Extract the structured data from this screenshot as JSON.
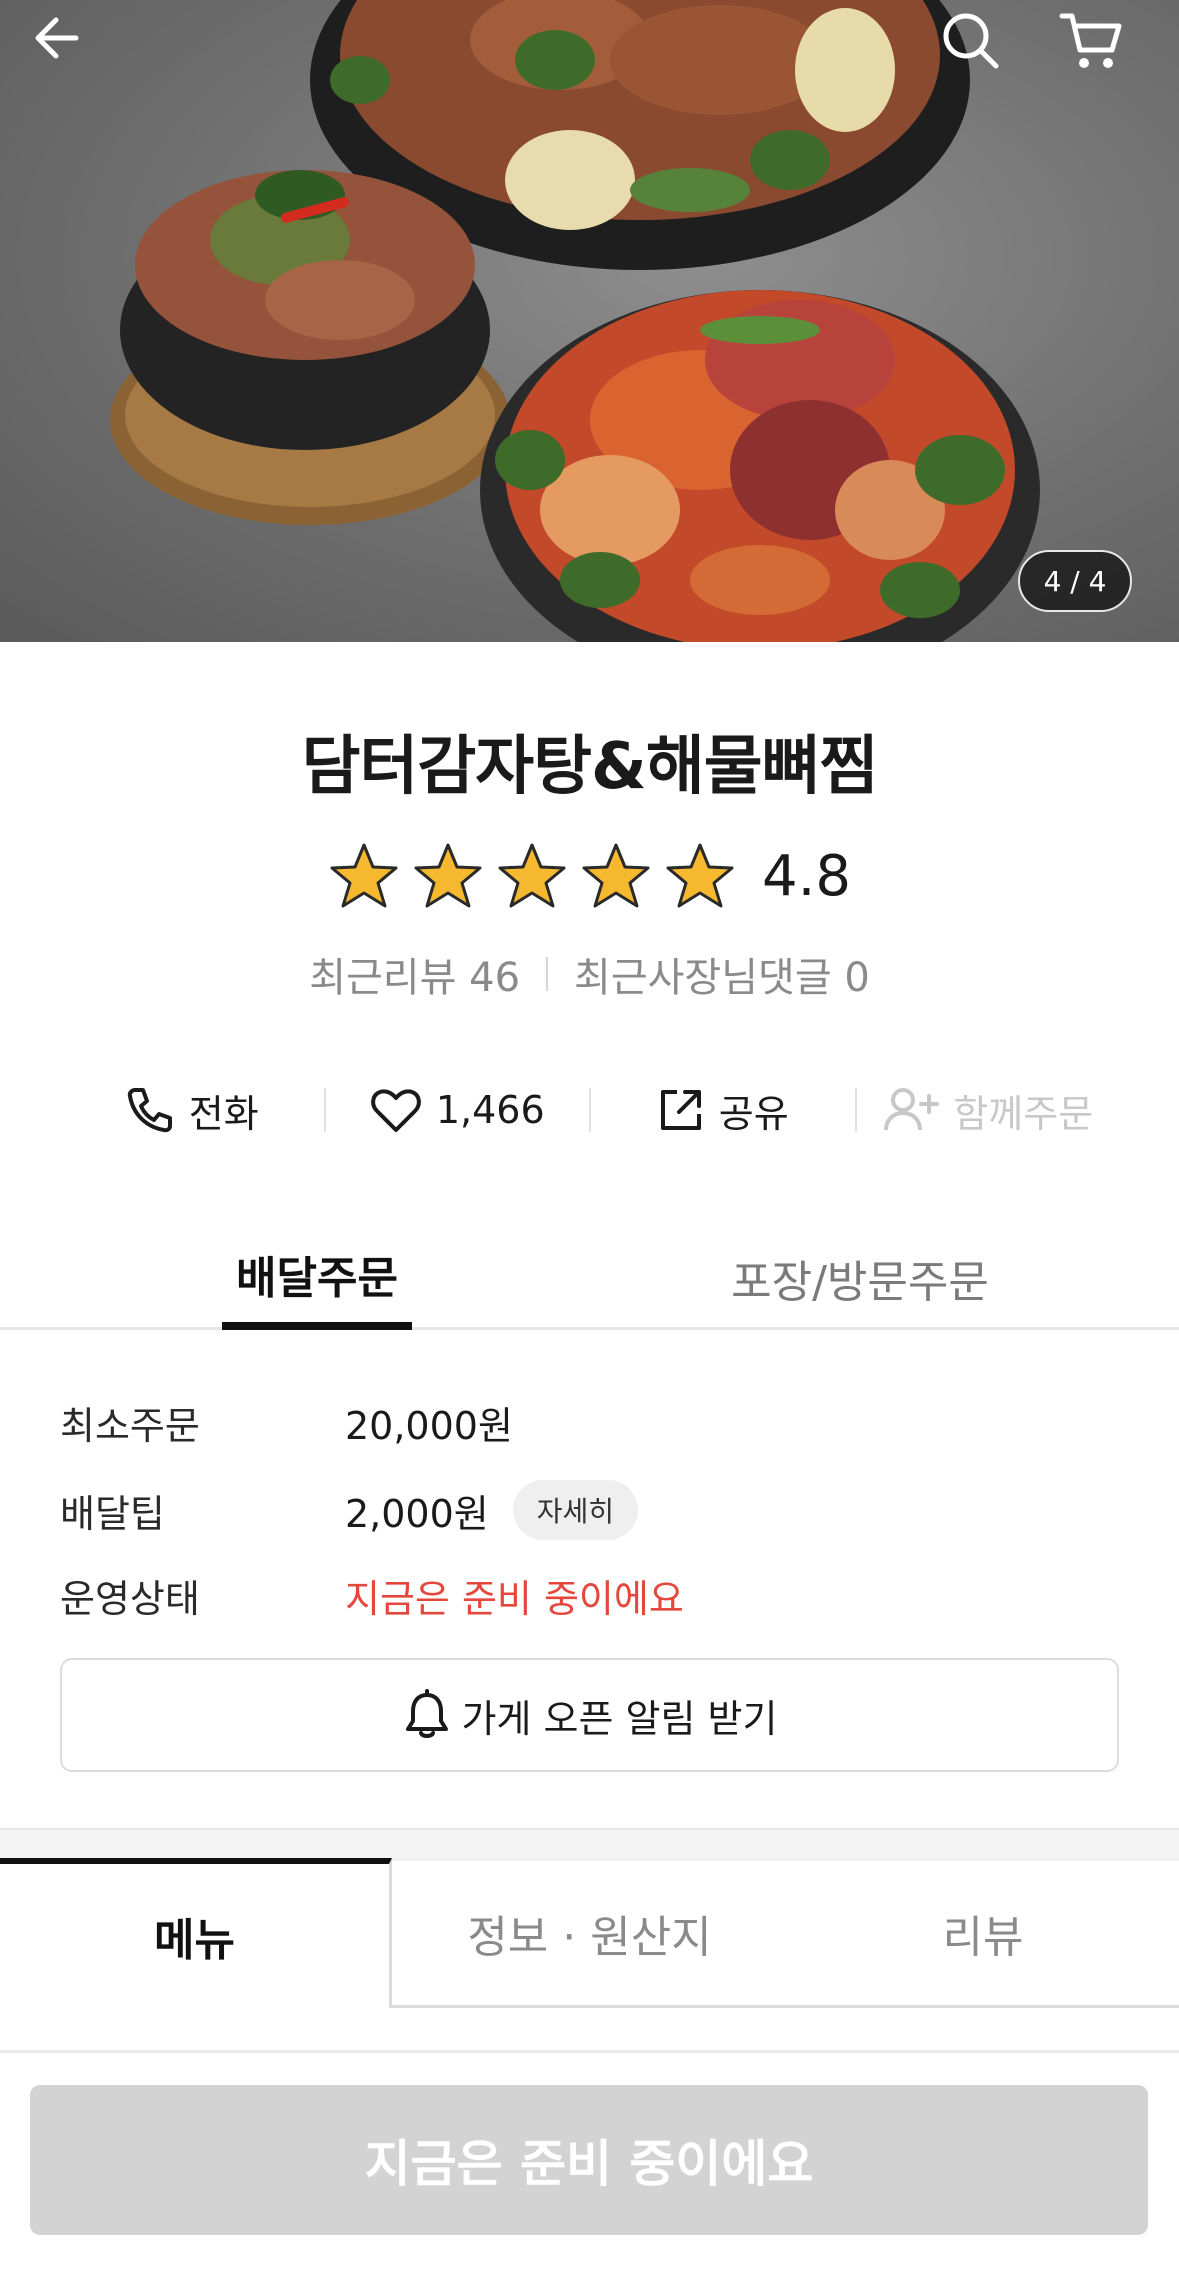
{
  "hero": {
    "image_alt": "담터감자탕&해물뼈찜 food photo",
    "counter": "4 / 4"
  },
  "store": {
    "name": "담터감자탕&해물뼈찜",
    "rating": "4.8",
    "stars": 5,
    "recent_reviews": "최근리뷰 46",
    "owner_replies": "최근사장님댓글 0"
  },
  "actions": {
    "call": "전화",
    "like_count": "1,466",
    "share": "공유",
    "group_order": "함께주문"
  },
  "order_tabs": {
    "delivery": "배달주문",
    "pickup": "포장/방문주문"
  },
  "info": {
    "min_order_label": "최소주문",
    "min_order_value": "20,000원",
    "delivery_tip_label": "배달팁",
    "delivery_tip_value": "2,000원",
    "detail_chip": "자세히",
    "status_label": "운영상태",
    "status_value": "지금은 준비 중이에요",
    "open_alarm": "가게 오픈 알림 받기"
  },
  "bottom_tabs": {
    "menu": "메뉴",
    "info": "정보 · 원산지",
    "review": "리뷰"
  },
  "cta": {
    "label": "지금은 준비 중이에요"
  },
  "colors": {
    "status_red": "#e5473d",
    "star": "#f5b82e",
    "cta_disabled": "#d3d3d3"
  },
  "icons": [
    "back-arrow-icon",
    "search-icon",
    "cart-icon",
    "star-icon",
    "phone-icon",
    "heart-icon",
    "share-icon",
    "add-user-icon",
    "bell-icon"
  ]
}
